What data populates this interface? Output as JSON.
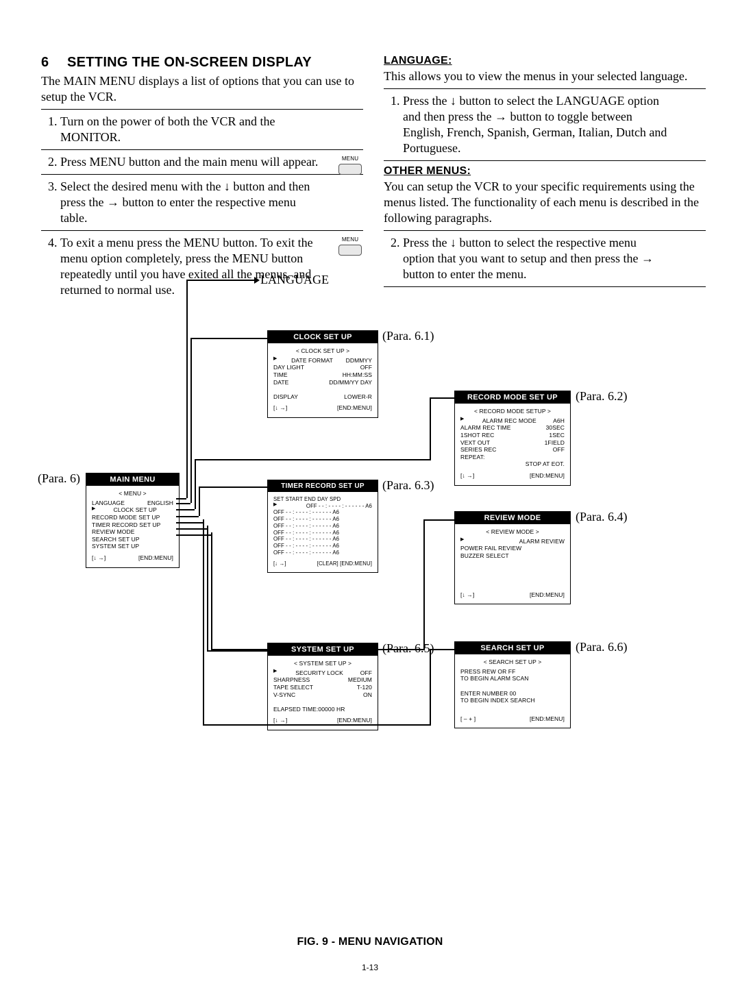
{
  "page_number": "1-13",
  "section_number": "6",
  "section_title": "SETTING THE ON-SCREEN DISPLAY",
  "intro_para": "The MAIN MENU displays a list of options that you can use to setup the VCR.",
  "left_steps": [
    "Turn on the power of both the VCR and the MONITOR.",
    "Press MENU button and the main menu will appear.",
    "Select the desired menu with the ↓ button and then press the → button to enter the respective menu table.",
    "To exit a menu press the MENU button. To exit the menu option completely, press the MENU button repeatedly until you have exited all the menus, and returned to normal use."
  ],
  "menu_btn_label": "MENU",
  "lang_heading": "LANGUAGE:",
  "lang_para": "This allows you to view the menus in your selected language.",
  "lang_step_1": "Press the ↓ button to select the LANGUAGE option and then press the → button to toggle between English, French, Spanish, German, Italian, Dutch and Portuguese.",
  "other_heading": "OTHER MENUS:",
  "other_para": "You can setup the VCR to your specific requirements using the menus listed.  The functionality of each menu is described in the following paragraphs.",
  "other_step_2": "Press the ↓ button to select the respective menu option that you want to setup and then press the → button to enter the menu.",
  "fig_caption": "FIG. 9 - MENU NAVIGATION",
  "label_language": "LANGUAGE",
  "main_menu": {
    "para": "(Para. 6)",
    "title": "MAIN MENU",
    "hdr": "< MENU >",
    "rows": [
      [
        "LANGUAGE",
        "ENGLISH"
      ],
      [
        "CLOCK SET UP",
        ""
      ],
      [
        "RECORD MODE SET UP",
        ""
      ],
      [
        "TIMER RECORD SET UP",
        ""
      ],
      [
        "REVIEW MODE",
        ""
      ],
      [
        "SEARCH SET UP",
        ""
      ],
      [
        "SYSTEM SET UP",
        ""
      ]
    ],
    "foot_left": "[↓  →]",
    "foot_right": "[END:MENU]"
  },
  "clock": {
    "para": "(Para. 6.1)",
    "title": "CLOCK SET UP",
    "hdr": "< CLOCK SET UP >",
    "rows": [
      [
        "DATE FORMAT",
        "DDMMYY"
      ],
      [
        "DAY LIGHT",
        "OFF"
      ],
      [
        "TIME",
        "HH:MM:SS"
      ],
      [
        "DATE",
        "DD/MM/YY DAY"
      ],
      [
        "",
        ""
      ],
      [
        "DISPLAY",
        "LOWER-R"
      ]
    ],
    "foot_left": "[↓  →]",
    "foot_right": "[END:MENU]"
  },
  "record": {
    "para": "(Para. 6.2)",
    "title": "RECORD MODE SET UP",
    "hdr": "< RECORD MODE SETUP >",
    "rows": [
      [
        "ALARM REC MODE",
        "A6H"
      ],
      [
        "ALARM REC TIME",
        "30SEC"
      ],
      [
        "1SHOT REC",
        "1SEC"
      ],
      [
        "VEXT OUT",
        "1FIELD"
      ],
      [
        "SERIES REC",
        "OFF"
      ],
      [
        "REPEAT:",
        ""
      ],
      [
        "",
        "STOP AT EOT."
      ]
    ],
    "foot_left": "[↓  →]",
    "foot_right": "[END:MENU]"
  },
  "timer": {
    "para": "(Para. 6.3)",
    "title": "TIMER RECORD SET UP",
    "hdr": " SET   START   END   DAY  SPD",
    "rows": [
      [
        "OFF  - - : - -   - - : - -   - - - -    A6"
      ],
      [
        "OFF  - - : - -   - - : - -   - - - -    A6"
      ],
      [
        "OFF  - - : - -   - - : - -   - - - -    A6"
      ],
      [
        "OFF  - - : - -   - - : - -   - - - -    A6"
      ],
      [
        "OFF  - - : - -   - - : - -   - - - -    A6"
      ],
      [
        "OFF  - - : - -   - - : - -   - - - -    A6"
      ],
      [
        "OFF  - - : - -   - - : - -   - - - -    A6"
      ],
      [
        "OFF  - - : - -   - - : - -   - - - -    A6"
      ]
    ],
    "foot_left": "[↓  →]",
    "foot_right": "[CLEAR]  [END:MENU]"
  },
  "review": {
    "para": "(Para. 6.4)",
    "title": "REVIEW MODE",
    "hdr": "< REVIEW MODE >",
    "rows": [
      [
        "ALARM REVIEW"
      ],
      [
        "POWER FAIL REVIEW"
      ],
      [
        "BUZZER SELECT"
      ]
    ],
    "foot_left": "[↓  →]",
    "foot_right": "[END:MENU]"
  },
  "system": {
    "para": "(Para. 6.5)",
    "title": "SYSTEM SET UP",
    "hdr": "< SYSTEM SET UP >",
    "rows": [
      [
        "SECURITY LOCK",
        "OFF"
      ],
      [
        "SHARPNESS",
        "MEDIUM"
      ],
      [
        "TAPE SELECT",
        "T-120"
      ],
      [
        "V-SYNC",
        "ON"
      ],
      [
        "",
        ""
      ],
      [
        "ELAPSED TIME:00000 HR",
        ""
      ]
    ],
    "foot_left": "[↓  →]",
    "foot_right": "[END:MENU]"
  },
  "search": {
    "para": "(Para. 6.6)",
    "title": "SEARCH SET UP",
    "hdr": "< SEARCH SET UP >",
    "lines": [
      "PRESS REW OR FF",
      "TO BEGIN ALARM SCAN",
      "",
      "ENTER NUMBER 00",
      "TO BEGIN INDEX SEARCH"
    ],
    "foot_left": "[ –    + ]",
    "foot_right": "[END:MENU]"
  }
}
